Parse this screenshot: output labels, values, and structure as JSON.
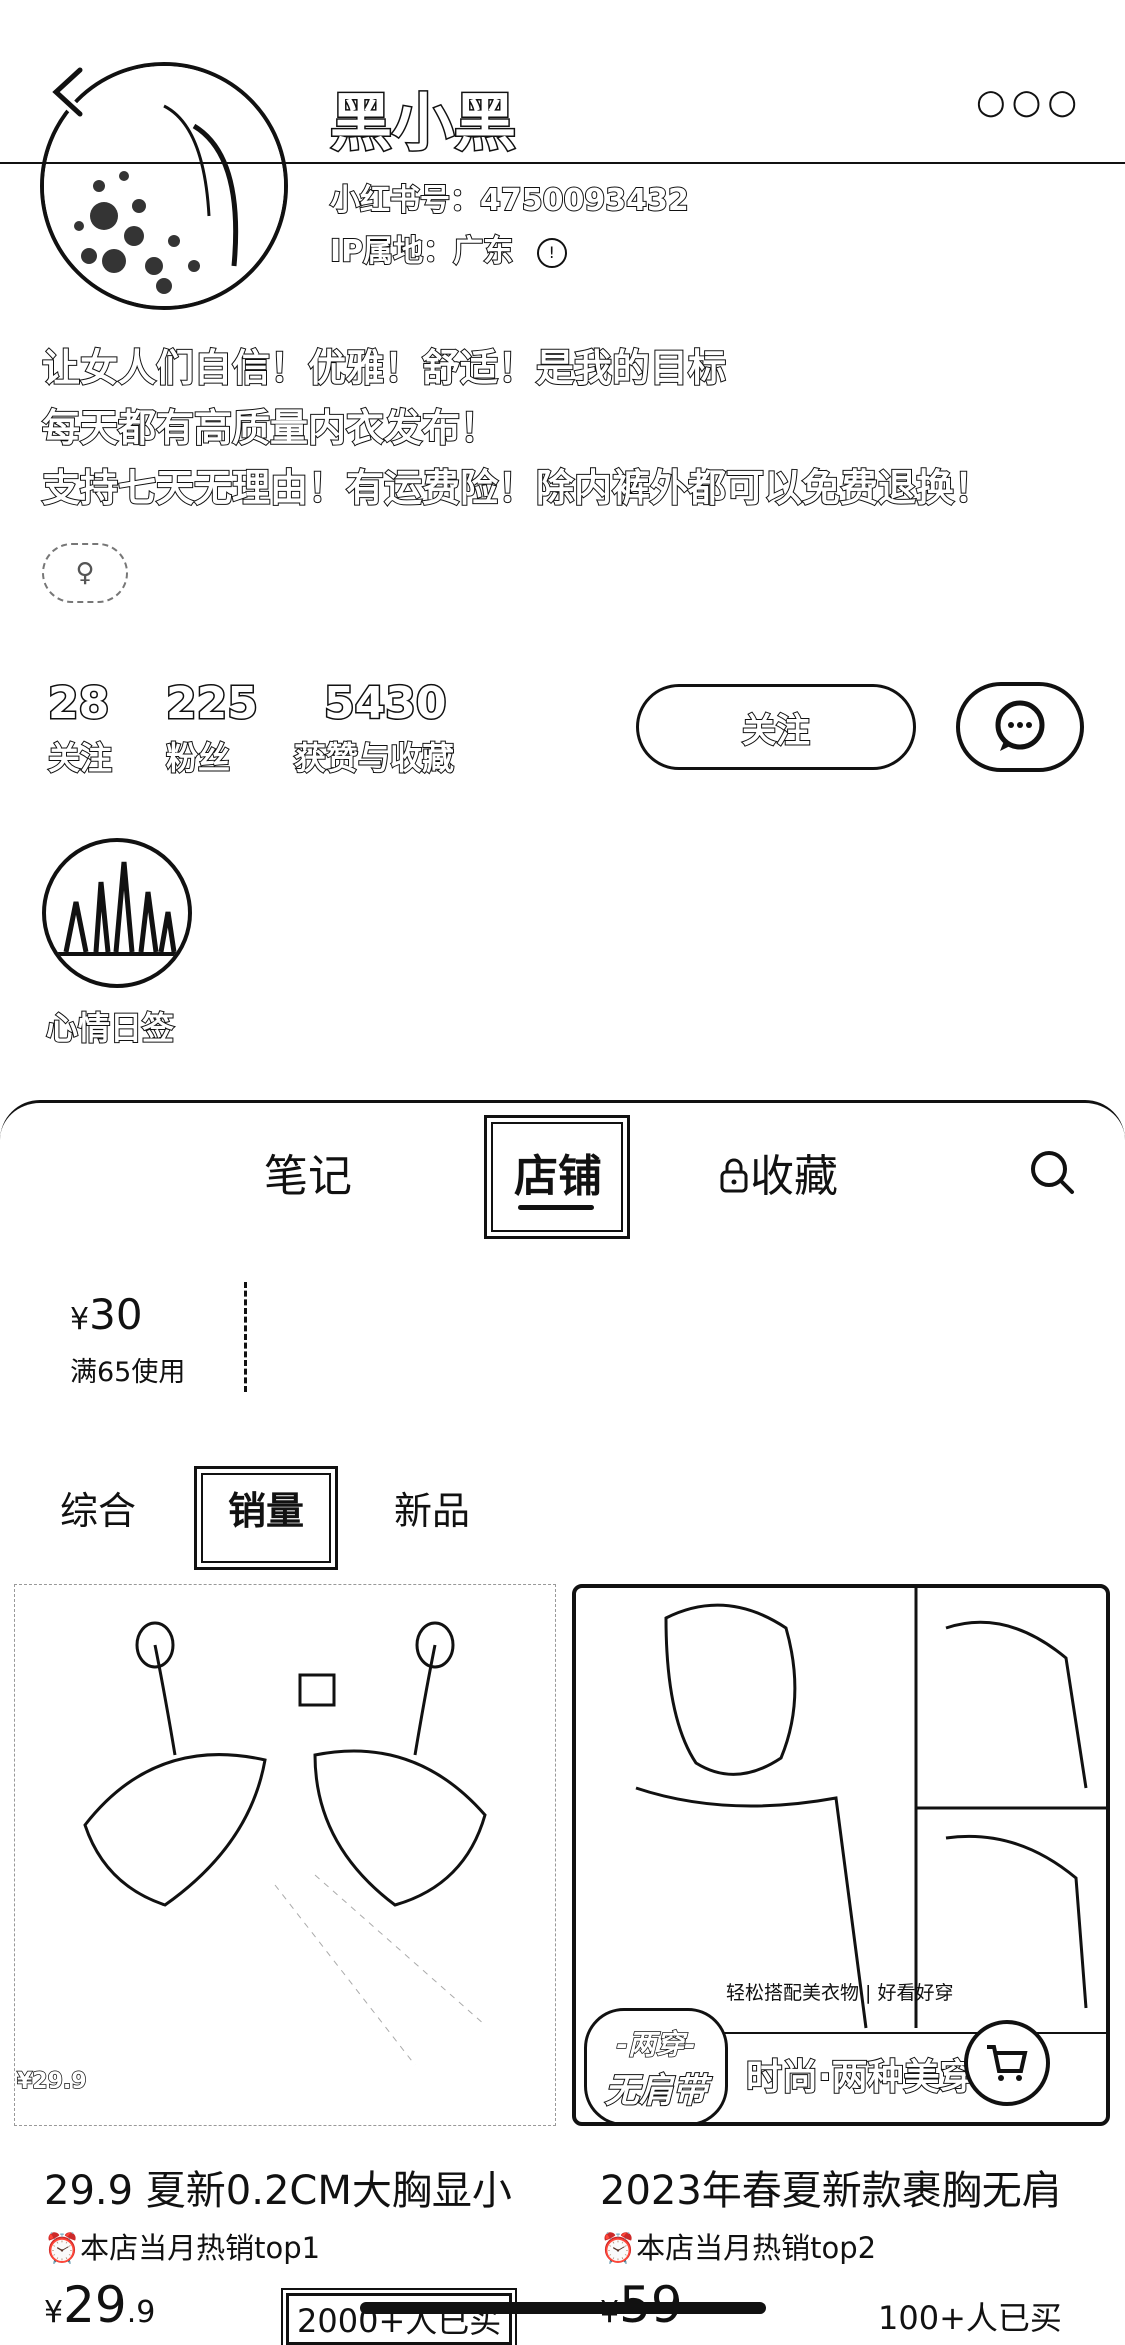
{
  "profile": {
    "name": "黑小黑",
    "red_id": "小红书号：4750093432",
    "ip_location": "IP属地：广东",
    "bio": [
      "让女人们自信！优雅！舒适！是我的目标",
      "每天都有高质量内衣发布！",
      "支持七天无理由！有运费险！除内裤外都可以免费退换！"
    ],
    "gender_icon": "female-icon"
  },
  "stats": [
    {
      "value": "28",
      "label": "关注"
    },
    {
      "value": "225",
      "label": "粉丝"
    },
    {
      "value": "5430",
      "label": "获赞与收藏"
    }
  ],
  "actions": {
    "follow": "关注",
    "message_icon": "chat-icon"
  },
  "mood": {
    "label": "心情日签"
  },
  "tabs": [
    {
      "label": "笔记",
      "active": false
    },
    {
      "label": "店铺",
      "active": true
    },
    {
      "label": "收藏",
      "active": false,
      "locked": true
    }
  ],
  "coupon": {
    "symbol": "¥",
    "amount": "30",
    "condition": "满65使用"
  },
  "sort": [
    {
      "label": "综合",
      "active": false
    },
    {
      "label": "销量",
      "active": true
    },
    {
      "label": "新品",
      "active": false
    }
  ],
  "products": [
    {
      "title": "29.9 夏新0.2CM大胸显小",
      "tag": "本店当月热销top1",
      "price_symbol": "¥",
      "price_int": "29",
      "price_dec": ".9",
      "sold": "2000+人已买",
      "img_caption": "¥29.9"
    },
    {
      "title": "2023年春夏新款裹胸无肩",
      "tag": "本店当月热销top2",
      "price_symbol": "¥",
      "price_int": "59",
      "price_dec": "",
      "sold": "100+人已买",
      "img_badge_line1": "-两穿-",
      "img_badge_line2": "无肩带",
      "img_banner": "时尚·两种美穿法",
      "img_sub": "轻松搭配美衣物 | 好看好穿"
    }
  ],
  "colors": {
    "ink": "#111111",
    "background": "#ffffff"
  }
}
